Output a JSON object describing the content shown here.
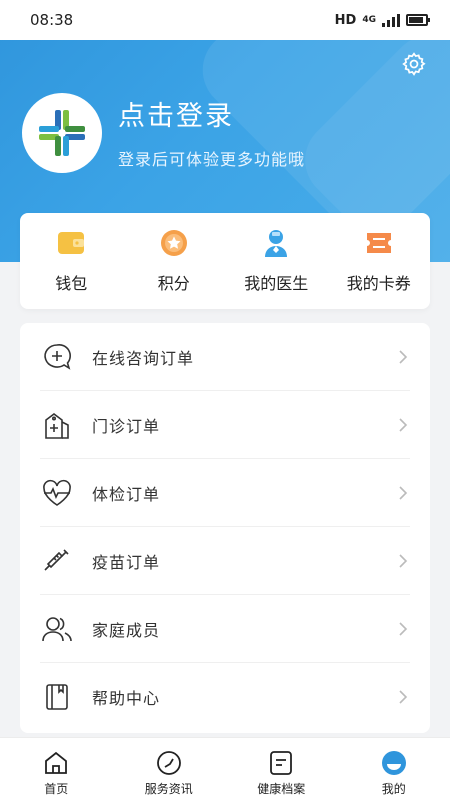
{
  "status_bar": {
    "time": "08:38",
    "hd": "HD",
    "network": "4G"
  },
  "header": {
    "title": "点击登录",
    "subtitle": "登录后可体验更多功能哦",
    "settings_icon": "gear-icon",
    "colors": {
      "gradient_start": "#2f95dc",
      "gradient_end": "#49ade9"
    }
  },
  "quick_actions": [
    {
      "label": "钱包",
      "icon": "wallet-icon",
      "color": "#f5c143"
    },
    {
      "label": "积分",
      "icon": "points-star-icon",
      "color": "#f5a04a"
    },
    {
      "label": "我的医生",
      "icon": "doctor-icon",
      "color": "#3ba3e6"
    },
    {
      "label": "我的卡券",
      "icon": "coupon-icon",
      "color": "#f58a4a"
    }
  ],
  "menu": [
    {
      "label": "在线咨询订单",
      "icon": "chat-plus-icon"
    },
    {
      "label": "门诊订单",
      "icon": "clinic-icon"
    },
    {
      "label": "体检订单",
      "icon": "heartbeat-icon"
    },
    {
      "label": "疫苗订单",
      "icon": "syringe-icon"
    },
    {
      "label": "家庭成员",
      "icon": "family-icon"
    },
    {
      "label": "帮助中心",
      "icon": "book-icon"
    }
  ],
  "tabbar": [
    {
      "label": "首页",
      "icon": "home-icon",
      "active": false
    },
    {
      "label": "服务资讯",
      "icon": "compass-icon",
      "active": false
    },
    {
      "label": "健康档案",
      "icon": "record-icon",
      "active": false
    },
    {
      "label": "我的",
      "icon": "profile-icon",
      "active": true
    }
  ],
  "accent_color": "#2f95dc"
}
